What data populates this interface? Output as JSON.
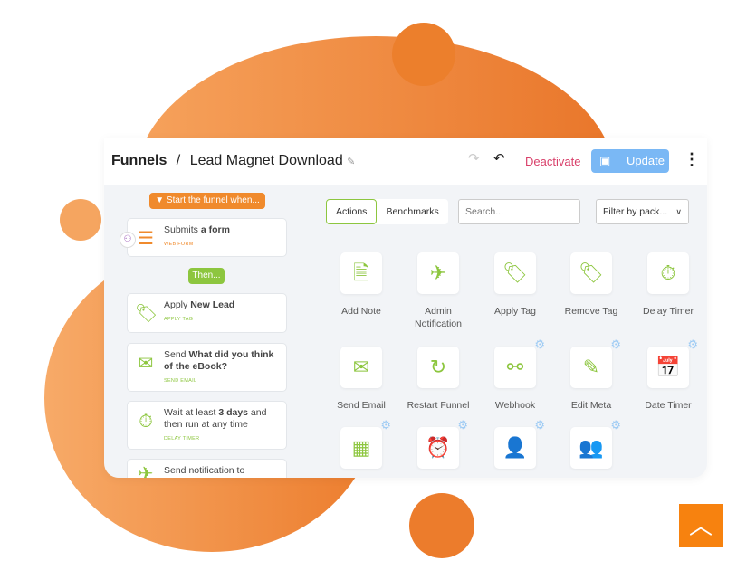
{
  "header": {
    "breadcrumb_root": "Funnels",
    "separator": "/",
    "funnel_name": "Lead Magnet Download",
    "deactivate_label": "Deactivate",
    "update_label": "Update"
  },
  "colors": {
    "orange": "#f08a2c",
    "green": "#8dc63f",
    "deactivate": "#d9416b",
    "update_bg": "#7ab8f5"
  },
  "funnel": {
    "start_label": "Start the funnel when...",
    "then_label": "Then...",
    "trigger": {
      "text": "Submits ",
      "bold": "a form",
      "sub": "WEB FORM"
    },
    "steps": [
      {
        "text": "Apply ",
        "bold": "New Lead",
        "after": "",
        "sub": "APPLY TAG",
        "icon": "tag-plus-icon"
      },
      {
        "text": "Send ",
        "bold": "What did you think of the eBook?",
        "after": "",
        "sub": "SEND EMAIL",
        "icon": "email-icon"
      },
      {
        "text": "Wait at least ",
        "bold": "3 days",
        "after": " and then run at any time",
        "sub": "DELAY TIMER",
        "icon": "timer-icon"
      },
      {
        "text": "Send notification to",
        "bold": "",
        "after": "",
        "sub": "",
        "icon": "admin-notification-icon"
      }
    ]
  },
  "panel": {
    "tabs": [
      {
        "label": "Actions",
        "active": true
      },
      {
        "label": "Benchmarks",
        "active": false
      }
    ],
    "search_placeholder": "Search...",
    "filter_label": "Filter by pack...",
    "actions": [
      {
        "label": "Add Note",
        "icon": "note-icon",
        "glyph": "🗎",
        "gear": false
      },
      {
        "label": "Admin Notification",
        "icon": "paper-plane-icon",
        "glyph": "✈",
        "gear": false
      },
      {
        "label": "Apply Tag",
        "icon": "tag-plus-icon",
        "glyph": "🏷",
        "gear": false
      },
      {
        "label": "Remove Tag",
        "icon": "tag-minus-icon",
        "glyph": "🏷",
        "gear": false
      },
      {
        "label": "Delay Timer",
        "icon": "timer-icon",
        "glyph": "⏱",
        "gear": false
      },
      {
        "label": "Send Email",
        "icon": "email-icon",
        "glyph": "✉",
        "gear": false
      },
      {
        "label": "Restart Funnel",
        "icon": "restart-icon",
        "glyph": "↻",
        "gear": false
      },
      {
        "label": "Webhook",
        "icon": "webhook-icon",
        "glyph": "⚯",
        "gear": true
      },
      {
        "label": "Edit Meta",
        "icon": "edit-meta-icon",
        "glyph": "✎",
        "gear": true
      },
      {
        "label": "Date Timer",
        "icon": "calendar-icon",
        "glyph": "📅",
        "gear": true
      },
      {
        "label": "",
        "icon": "calendar-list-icon",
        "glyph": "▦",
        "gear": true
      },
      {
        "label": "",
        "icon": "alarm-icon",
        "glyph": "⏰",
        "gear": true
      },
      {
        "label": "",
        "icon": "user-star-icon",
        "glyph": "👤",
        "gear": true
      },
      {
        "label": "",
        "icon": "group-check-icon",
        "glyph": "👥",
        "gear": true
      }
    ]
  }
}
